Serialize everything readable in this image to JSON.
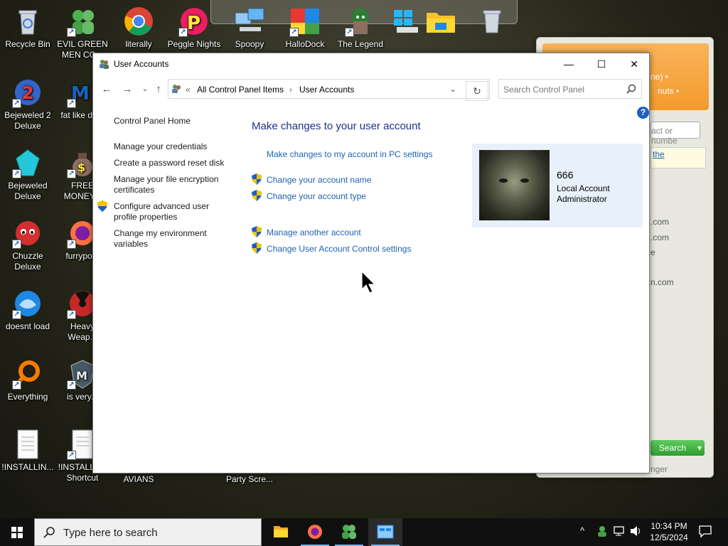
{
  "desktop": {
    "icons": [
      {
        "label": "Recycle Bin"
      },
      {
        "label": "EVIL GREEN MEN CO..."
      },
      {
        "label": "literally"
      },
      {
        "label": "Peggle Nights"
      },
      {
        "label": "Spoopy"
      },
      {
        "label": "HalloDock"
      },
      {
        "label": "The Legend"
      },
      {
        "label": "Bejeweled 2 Deluxe"
      },
      {
        "label": "fat like da..."
      },
      {
        "label": "Bejeweled Deluxe"
      },
      {
        "label": "FREE MONEY..."
      },
      {
        "label": "Chuzzle Deluxe"
      },
      {
        "label": "furrypo..."
      },
      {
        "label": "doesnt load"
      },
      {
        "label": "Heavy Weap..."
      },
      {
        "label": "Everything"
      },
      {
        "label": "is very..."
      },
      {
        "label": "!INSTALLIN..."
      },
      {
        "label": "!INSTALL... - Shortcut"
      },
      {
        "label": "AVIANS"
      },
      {
        "label": "Party Scre..."
      }
    ]
  },
  "messenger": {
    "texts": [
      "ne) •",
      "nuts •",
      "act or numbe",
      "the",
      ".com",
      ".com",
      "e",
      "n.com",
      "nger"
    ],
    "search_label": "Search"
  },
  "window": {
    "title": "User Accounts",
    "controls": {
      "minimize": "—",
      "maximize": "☐",
      "close": "✕"
    },
    "address": {
      "prefix": "«",
      "crumbs": [
        "All Control Panel Items",
        "User Accounts"
      ],
      "separator": "›"
    },
    "search_placeholder": "Search Control Panel",
    "help": "?",
    "left_nav": {
      "home": "Control Panel Home",
      "items": [
        "Manage your credentials",
        "Create a password reset disk",
        "Manage your file encryption certificates",
        "Configure advanced user profile properties",
        "Change my environment variables"
      ]
    },
    "main": {
      "heading": "Make changes to your user account",
      "pc_settings_link": "Make changes to my account in PC settings",
      "links": [
        "Change your account name",
        "Change your account type",
        "Manage another account",
        "Change User Account Control settings"
      ]
    },
    "user": {
      "name": "666",
      "line1": "Local Account",
      "line2": "Administrator"
    }
  },
  "taskbar": {
    "search_placeholder": "Type here to search",
    "time": "10:34 PM",
    "date": "12/5/2024"
  },
  "colors": {
    "link": "#1e63b4",
    "heading": "#1e3287",
    "user_panel": "#e8f1fb",
    "accent": "#76b9ed"
  }
}
